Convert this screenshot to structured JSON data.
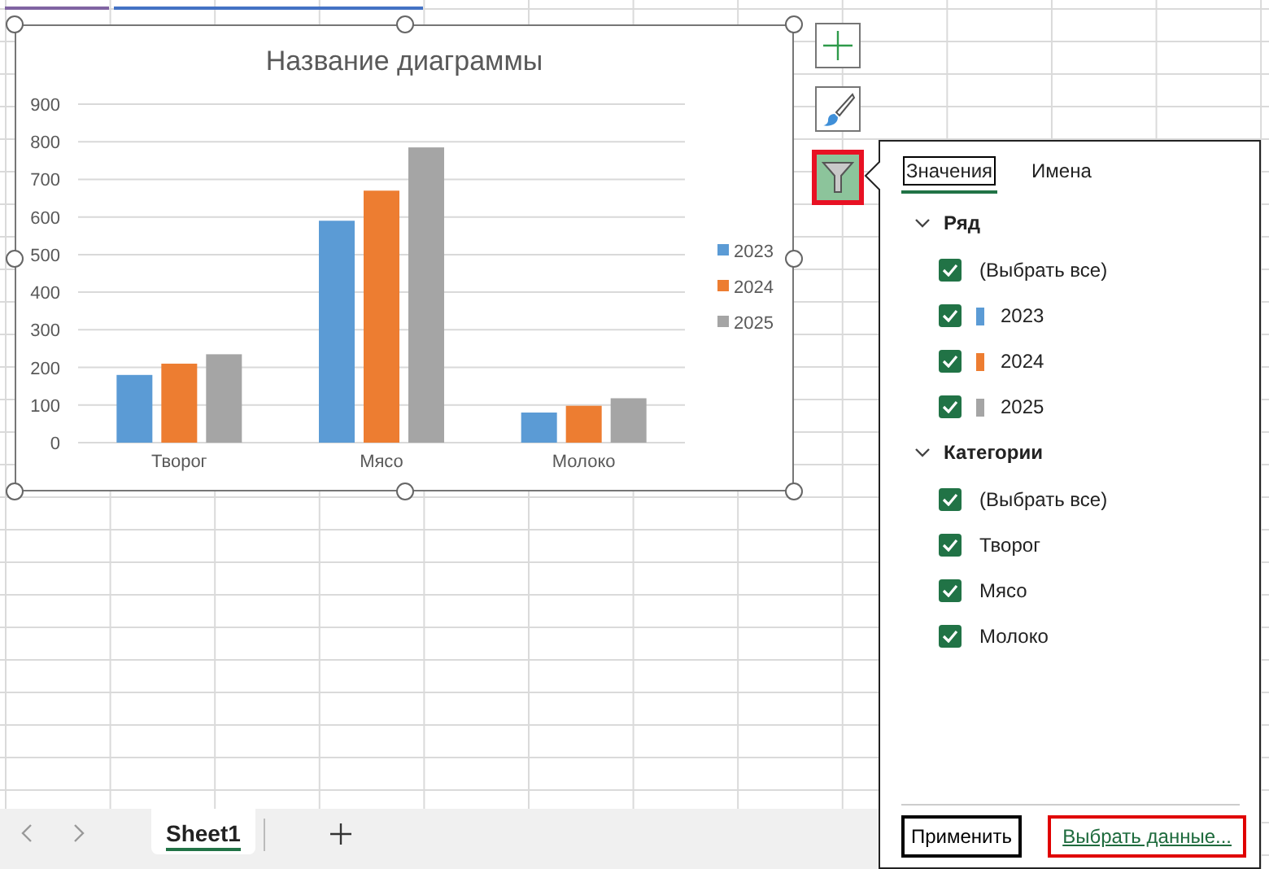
{
  "chart": {
    "chart_data": {
      "type": "bar",
      "title": "Название диаграммы",
      "categories": [
        "Творог",
        "Мясо",
        "Молоко"
      ],
      "series": [
        {
          "name": "2023",
          "color": "#5b9bd5",
          "values": [
            180,
            590,
            80
          ]
        },
        {
          "name": "2024",
          "color": "#ed7d31",
          "values": [
            210,
            670,
            98
          ]
        },
        {
          "name": "2025",
          "color": "#a5a5a5",
          "values": [
            235,
            785,
            118
          ]
        }
      ],
      "ylim": [
        0,
        900
      ],
      "grid": true,
      "legend": "right",
      "yticks": [
        0,
        100,
        200,
        300,
        400,
        500,
        600,
        700,
        800,
        900
      ]
    }
  },
  "chart_tools": [
    {
      "kind": "add",
      "selected": false
    },
    {
      "kind": "style",
      "selected": false
    },
    {
      "kind": "filter",
      "selected": true
    }
  ],
  "filter_panel": {
    "tabs": [
      {
        "label": "Значения",
        "selected": true
      },
      {
        "label": "Имена",
        "selected": false
      }
    ],
    "sections": [
      {
        "title": "Ряд",
        "expanded": true,
        "items": [
          {
            "label": "(Выбрать все)",
            "checked": true
          },
          {
            "label": "2023",
            "checked": true,
            "color": "#5b9bd5"
          },
          {
            "label": "2024",
            "checked": true,
            "color": "#ed7d31"
          },
          {
            "label": "2025",
            "checked": true,
            "color": "#a5a5a5"
          }
        ]
      },
      {
        "title": "Категории",
        "expanded": true,
        "items": [
          {
            "label": "(Выбрать все)",
            "checked": true
          },
          {
            "label": "Творог",
            "checked": true
          },
          {
            "label": "Мясо",
            "checked": true
          },
          {
            "label": "Молоко",
            "checked": true
          }
        ]
      }
    ],
    "apply_button": "Применить",
    "select_data_link": "Выбрать данные..."
  },
  "sheet_tabs": [
    {
      "label": "Sheet1",
      "selected": true
    }
  ]
}
